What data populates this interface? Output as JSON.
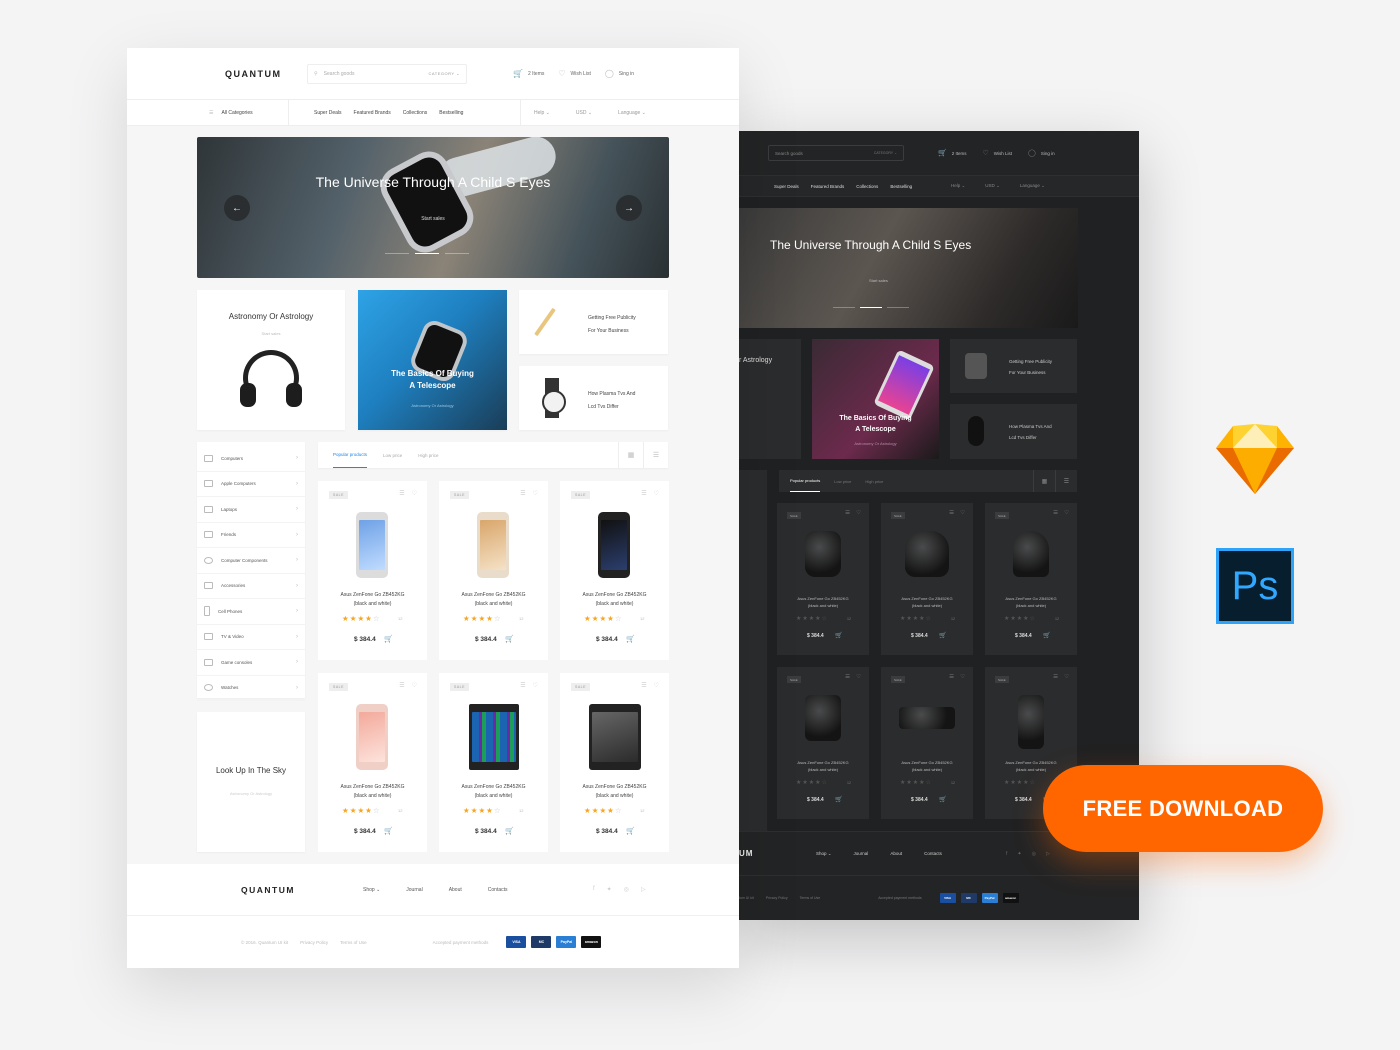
{
  "light": {
    "logo": "QUANTUM",
    "search_placeholder": "Search goods",
    "category_label": "CATEGORY",
    "cart_label": "2 Items",
    "wishlist_label": "Wish List",
    "signin_label": "Sing in",
    "nav": {
      "all_categories": "All Categories",
      "links": [
        "Super Deals",
        "Featured Brands",
        "Collections",
        "Bestselling"
      ],
      "dropdowns": [
        "Help",
        "USD",
        "Language"
      ]
    },
    "hero": {
      "title": "The Universe Through A Child S Eyes",
      "subtitle": "Start sales"
    },
    "promos": [
      {
        "title": "Astronomy Or Astrology",
        "subtitle": "Start sales"
      },
      {
        "title_line1": "The Basics Of Buying",
        "title_line2": "A Telescope",
        "subtitle": "Astronomy Or Astrology"
      },
      {
        "line1": "Getting Free Publicity",
        "line2": "For Your Business"
      },
      {
        "line1": "How Plasma Tvs And",
        "line2": "Lcd Tvs Differ"
      }
    ],
    "categories": [
      "Computers",
      "Apple Computers",
      "Laptops",
      "Friends",
      "Computer Components",
      "Accessories",
      "Cell Phones",
      "TV & Video",
      "Game consoles",
      "Watches"
    ],
    "look_card": {
      "title": "Look Up In The Sky",
      "subtitle": "Astronomy Or Astrology"
    },
    "tabs": [
      "Popular products",
      "Low price",
      "High price"
    ],
    "products": [
      {
        "sale": "SALE",
        "name1": "Asus ZenFone Go ZB452KG",
        "name2": "(black and white)",
        "rating": 3.5,
        "reviews": "12",
        "price": "$ 384.4"
      },
      {
        "sale": "SALE",
        "name1": "Asus ZenFone Go ZB452KG",
        "name2": "(black and white)",
        "rating": 3.5,
        "reviews": "12",
        "price": "$ 384.4"
      },
      {
        "sale": "SALE",
        "name1": "Asus ZenFone Go ZB452KG",
        "name2": "(black and white)",
        "rating": 3.5,
        "reviews": "12",
        "price": "$ 384.4"
      },
      {
        "sale": "SALE",
        "name1": "Asus ZenFone Go ZB452KG",
        "name2": "(black and white)",
        "rating": 3.5,
        "reviews": "12",
        "price": "$ 384.4"
      },
      {
        "sale": "SALE",
        "name1": "Asus ZenFone Go ZB452KG",
        "name2": "(black and white)",
        "rating": 3.5,
        "reviews": "12",
        "price": "$ 384.4"
      },
      {
        "sale": "SALE",
        "name1": "Asus ZenFone Go ZB452KG",
        "name2": "(black and white)",
        "rating": 3.5,
        "reviews": "12",
        "price": "$ 384.4"
      }
    ],
    "footer": {
      "logo": "QUANTUM",
      "links": [
        "Shop",
        "Journal",
        "About",
        "Contacts"
      ],
      "copyright": "© 2016. Quantum UI kit",
      "privacy": "Privacy Policy",
      "terms": "Terms of Use",
      "accepted": "Accepted payment methods",
      "payments": [
        "VISA",
        "MC",
        "PayPal",
        "amazon"
      ]
    }
  },
  "dark": {
    "search_placeholder": "Search goods",
    "category_label": "CATEGORY",
    "cart_label": "2 Items",
    "wishlist_label": "Wish List",
    "signin_label": "Sing in",
    "nav_links": [
      "Super Deals",
      "Featured Brands",
      "Collections",
      "Bestselling"
    ],
    "nav_dropdowns": [
      "Help",
      "USD",
      "Language"
    ],
    "hero": {
      "title": "The Universe Through A Child S Eyes",
      "subtitle": "Start sales"
    },
    "promo1_title": "r Astrology",
    "promo2": {
      "line1": "The Basics Of Buying",
      "line2": "A Telescope",
      "subtitle": "Astronomy Or Astrology"
    },
    "promo3": {
      "line1": "Getting Free Publicity",
      "line2": "For Your Business"
    },
    "promo4": {
      "line1": "How Plasma Tvs And",
      "line2": "Lcd Tvs Differ"
    },
    "tabs": [
      "Popular products",
      "Low price",
      "High price"
    ],
    "product": {
      "sale": "SALE",
      "name1": "Asus ZenFone Go ZB452KG",
      "name2": "(black and white)",
      "reviews": "12",
      "price": "$ 384.4"
    },
    "footer": {
      "logo": "UM",
      "links": [
        "Shop",
        "Journal",
        "About",
        "Contacts"
      ],
      "copyright": "tum UI kit",
      "privacy": "Privacy Policy",
      "terms": "Terms of Use",
      "accepted": "Accepted payment methods"
    }
  },
  "cta_label": "FREE DOWNLOAD",
  "ps_label": "Ps",
  "colors": {
    "accent": "#1e88e5",
    "cta": "#ff6600",
    "star": "#f5a623",
    "dark_bg": "#202122"
  }
}
